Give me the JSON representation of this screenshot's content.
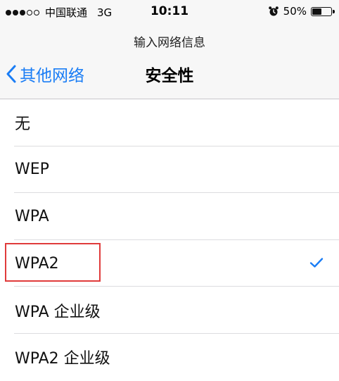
{
  "status_bar": {
    "signal_dots_filled": 3,
    "signal_dots_total": 5,
    "carrier": "中国联通",
    "network": "3G",
    "time": "10:11",
    "alarm_icon": "alarm-clock-icon",
    "battery_text": "50%",
    "battery_level": 0.5
  },
  "nav": {
    "prompt": "输入网络信息",
    "back_label": "其他网络",
    "title": "安全性"
  },
  "security_options": [
    {
      "label": "无",
      "selected": false
    },
    {
      "label": "WEP",
      "selected": false
    },
    {
      "label": "WPA",
      "selected": false
    },
    {
      "label": "WPA2",
      "selected": true
    },
    {
      "label": "WPA 企业级",
      "selected": false
    },
    {
      "label": "WPA2 企业级",
      "selected": false
    }
  ],
  "colors": {
    "accent": "#1a7df5",
    "highlight": "#e03b3b"
  }
}
